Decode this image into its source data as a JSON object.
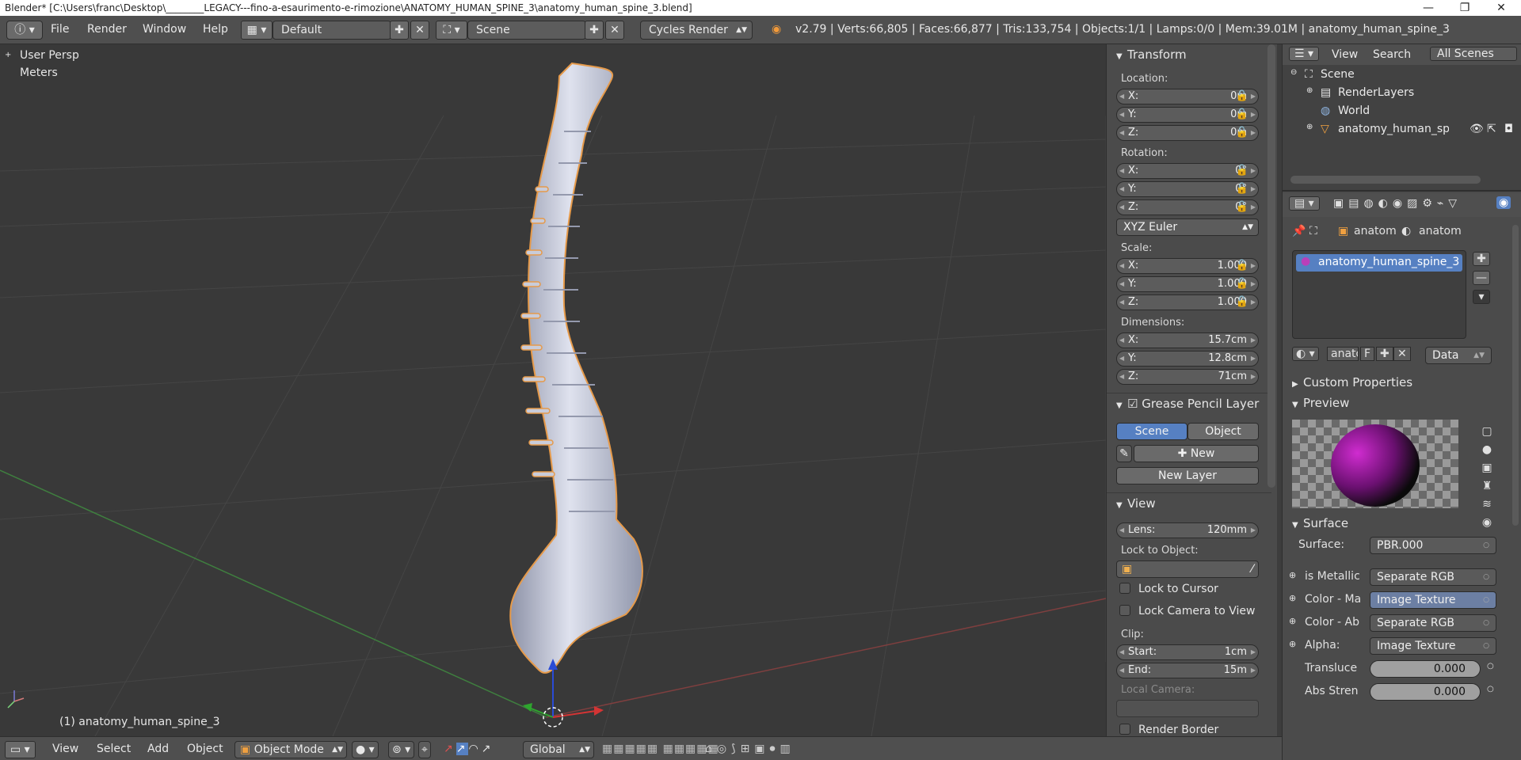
{
  "window": {
    "title": "Blender* [C:\\Users\\franc\\Desktop\\________LEGACY---fino-a-esaurimento-e-rimozione\\ANATOMY_HUMAN_SPINE_3\\anatomy_human_spine_3.blend]",
    "minimize": "—",
    "maximize": "❐",
    "close": "✕"
  },
  "infobar": {
    "menus": [
      "File",
      "Render",
      "Window",
      "Help"
    ],
    "screen_layout": "Default",
    "scene": "Scene",
    "render_engine": "Cycles Render",
    "stats": "v2.79 | Verts:66,805 | Faces:66,877 | Tris:133,754 | Objects:1/1 | Lamps:0/0 | Mem:39.01M | anatomy_human_spine_3"
  },
  "viewport": {
    "view_label": "User Persp",
    "units_label": "Meters",
    "object_label": "(1) anatomy_human_spine_3"
  },
  "npanel": {
    "transform": {
      "title": "Transform",
      "location_label": "Location:",
      "location": [
        {
          "k": "X:",
          "v": "0m"
        },
        {
          "k": "Y:",
          "v": "0m"
        },
        {
          "k": "Z:",
          "v": "0m"
        }
      ],
      "rotation_label": "Rotation:",
      "rotation": [
        {
          "k": "X:",
          "v": "0°"
        },
        {
          "k": "Y:",
          "v": "0°"
        },
        {
          "k": "Z:",
          "v": "0°"
        }
      ],
      "rotation_mode": "XYZ Euler",
      "scale_label": "Scale:",
      "scale": [
        {
          "k": "X:",
          "v": "1.000"
        },
        {
          "k": "Y:",
          "v": "1.000"
        },
        {
          "k": "Z:",
          "v": "1.000"
        }
      ],
      "dimensions_label": "Dimensions:",
      "dimensions": [
        {
          "k": "X:",
          "v": "15.7cm"
        },
        {
          "k": "Y:",
          "v": "12.8cm"
        },
        {
          "k": "Z:",
          "v": "71cm"
        }
      ]
    },
    "grease_pencil": {
      "title": "Grease Pencil Layer",
      "scene_tab": "Scene",
      "object_tab": "Object",
      "new_label": "New",
      "new_layer_label": "New Layer"
    },
    "view": {
      "title": "View",
      "lens_label": "Lens:",
      "lens_value": "120mm",
      "lock_object_label": "Lock to Object:",
      "lock_cursor": "Lock to Cursor",
      "lock_camera": "Lock Camera to View",
      "clip_label": "Clip:",
      "clip_start_label": "Start:",
      "clip_start": "1cm",
      "clip_end_label": "End:",
      "clip_end": "15m",
      "local_camera_label": "Local Camera:",
      "render_border": "Render Border"
    }
  },
  "outliner": {
    "view_menu": "View",
    "search_menu": "Search",
    "filter": "All Scenes",
    "items": [
      "Scene",
      "RenderLayers",
      "World",
      "anatomy_human_spine"
    ]
  },
  "properties": {
    "breadcrumb": [
      "anatom",
      "anatom"
    ],
    "material_slot": "anatomy_human_spine_3",
    "material_name": "anato",
    "fake_user": "F",
    "link": "Data",
    "custom_properties": "Custom Properties",
    "preview": "Preview",
    "surface_title": "Surface",
    "surface_label": "Surface:",
    "surface_value": "PBR.000",
    "inputs": [
      {
        "label": "is Metallic",
        "value": "Separate RGB",
        "selected": false
      },
      {
        "label": "Color - Ma",
        "value": "Image Texture",
        "selected": true
      },
      {
        "label": "Color - Ab",
        "value": "Separate RGB",
        "selected": false
      },
      {
        "label": "Alpha:",
        "value": "Image Texture",
        "selected": false
      }
    ],
    "translucency_label": "Transluce",
    "translucency_value": "0.000",
    "abs_strength_label": "Abs Stren",
    "abs_strength_value": "0.000"
  },
  "bottombar": {
    "menus": [
      "View",
      "Select",
      "Add",
      "Object"
    ],
    "mode": "Object Mode",
    "orientation": "Global"
  },
  "colors": {
    "accent_blue": "#5680c2",
    "viewport_bg": "#393939",
    "panel_bg": "#4b4b4b",
    "selection_orange": "#f29a3a"
  }
}
